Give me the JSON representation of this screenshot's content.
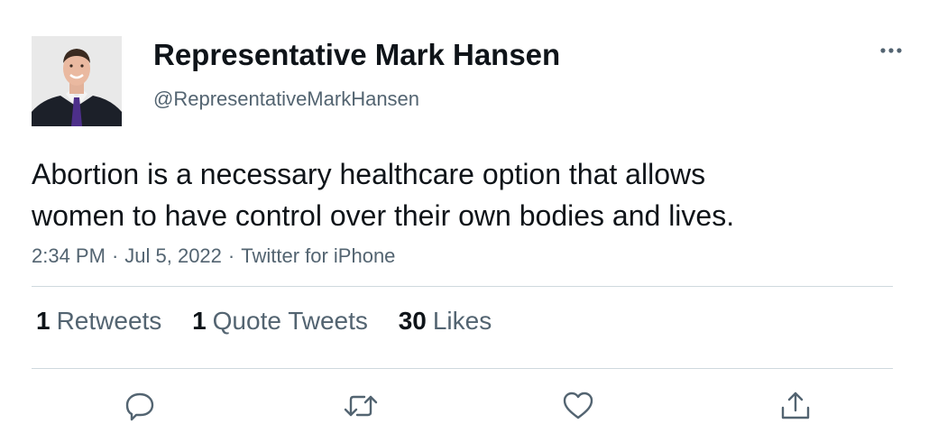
{
  "author": {
    "display_name": "Representative Mark Hansen",
    "handle": "@RepresentativeMarkHansen"
  },
  "tweet": {
    "text_lines": [
      "Abortion is a necessary healthcare option that allows",
      "women to have control over their own bodies and lives."
    ],
    "time": "2:34 PM",
    "separator": "·",
    "date": "Jul 5, 2022",
    "source": "Twitter for iPhone"
  },
  "stats": {
    "retweets": {
      "count": "1",
      "label": "Retweets"
    },
    "quote_tweets": {
      "count": "1",
      "label": "Quote Tweets"
    },
    "likes": {
      "count": "30",
      "label": "Likes"
    }
  },
  "icons": {
    "more": "more-horizontal-icon",
    "reply": "reply-icon",
    "retweet": "retweet-icon",
    "like": "heart-icon",
    "share": "share-icon"
  },
  "colors": {
    "text_primary": "#0f1419",
    "text_secondary": "#536471",
    "divider": "#cfd9de"
  }
}
